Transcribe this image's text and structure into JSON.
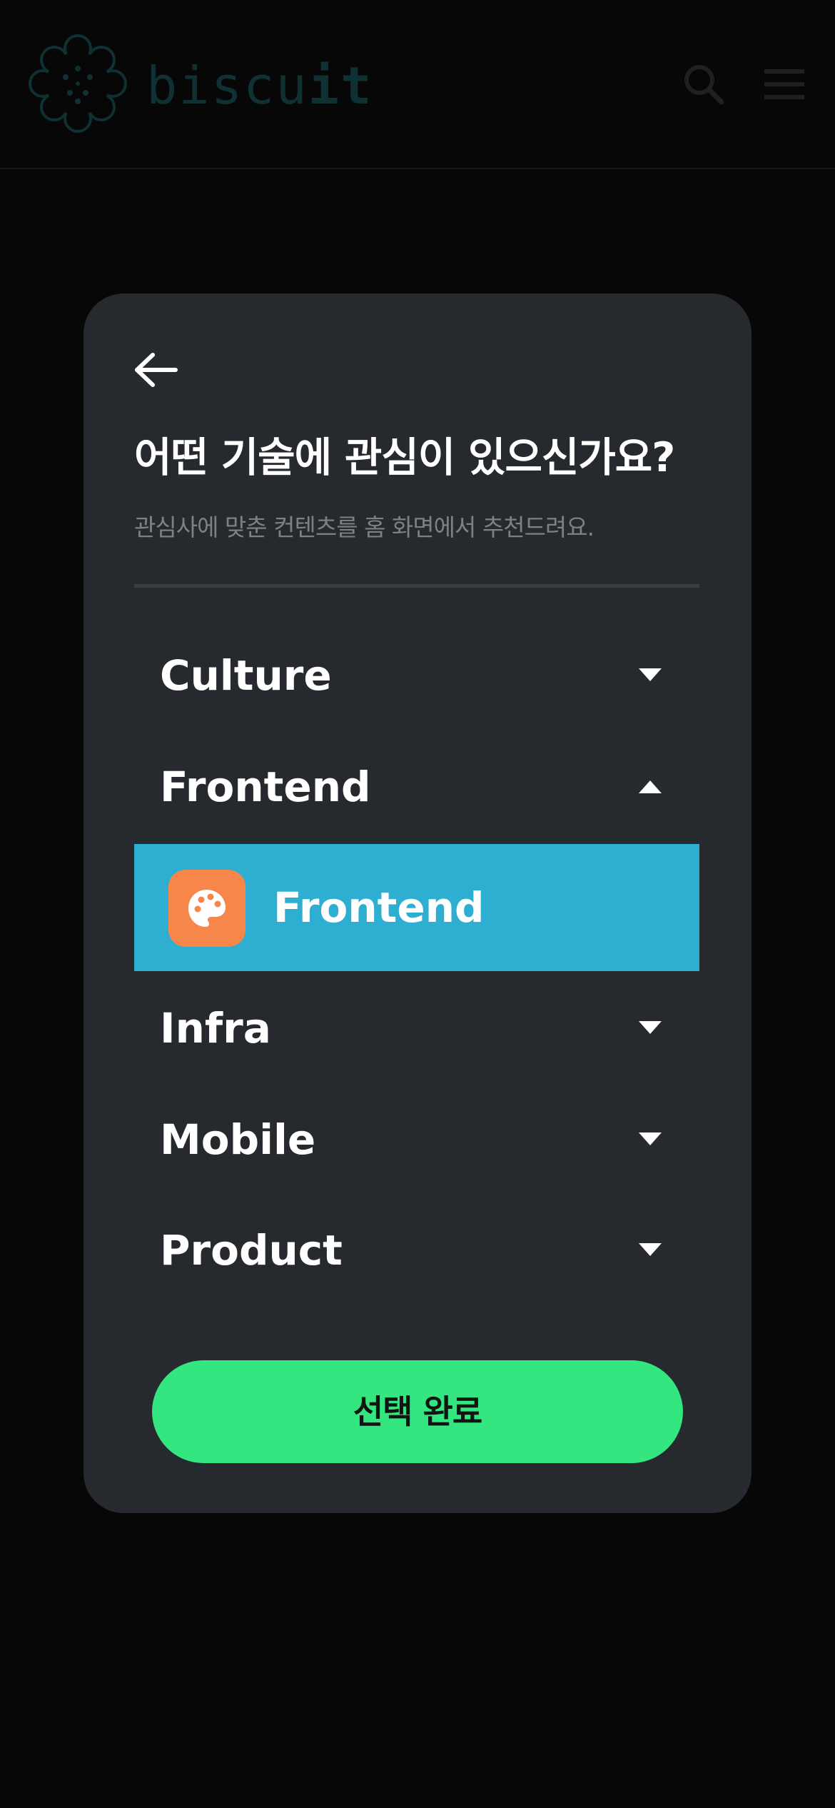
{
  "header": {
    "logo_text_light": "biscu",
    "logo_text_bold": "it",
    "logo_icon": "biscuit-logo-icon",
    "search_icon": "search-icon",
    "menu_icon": "hamburger-menu-icon"
  },
  "modal": {
    "back_icon": "arrow-left-icon",
    "title": "어떤 기술에 관심이 있으신가요?",
    "subtitle": "관심사에 맞춘 컨텐츠를 홈 화면에서 추천드려요.",
    "categories": [
      {
        "label": "Culture",
        "expanded": false
      },
      {
        "label": "Frontend",
        "expanded": true
      },
      {
        "label": "Infra",
        "expanded": false
      },
      {
        "label": "Mobile",
        "expanded": false
      },
      {
        "label": "Product",
        "expanded": false
      }
    ],
    "selected_sub_item": {
      "label": "Frontend",
      "icon": "palette-icon",
      "selected": true
    },
    "confirm_label": "선택 완료"
  },
  "colors": {
    "background": "#070707",
    "modal": "#26292d",
    "logo": "#0f3133",
    "selected_row": "#2eaed0",
    "icon_bg": "#f7864a",
    "confirm_button": "#33e67f"
  }
}
